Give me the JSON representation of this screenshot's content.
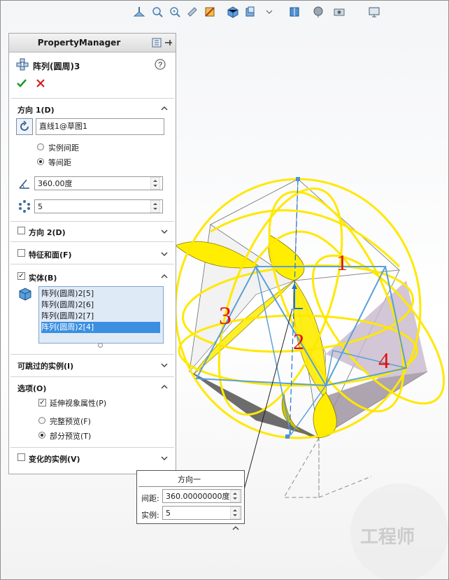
{
  "panel": {
    "title": "PropertyManager",
    "feature_name": "阵列(圆周)3",
    "ok_icon": "check-icon",
    "cancel_icon": "close-icon"
  },
  "direction1": {
    "header": "方向 1(D)",
    "axis_value": "直线1@草图1",
    "radio_instance_spacing": "实例间距",
    "radio_equal_spacing": "等间距",
    "selected_radio": "等间距",
    "angle_value": "360.00度",
    "count_value": "5"
  },
  "direction2": {
    "header": "方向 2(D)",
    "checked": false
  },
  "features_faces": {
    "header": "特征和面(F)",
    "checked": false
  },
  "bodies": {
    "header": "实体(B)",
    "checked": true,
    "items": [
      "阵列(圆周)2[5]",
      "阵列(圆周)2[6]",
      "阵列(圆周)2[7]",
      "阵列(圆周)2[4]"
    ],
    "selected_index": 3
  },
  "skip_instances": {
    "header": "可跳过的实例(I)"
  },
  "options": {
    "header": "选项(O)",
    "extend_visual": "延伸视象属性(P)",
    "extend_visual_checked": true,
    "full_preview": "完整预览(F)",
    "partial_preview": "部分预览(T)",
    "selected_preview": "部分预览(T)"
  },
  "varying_instances": {
    "header": "变化的实例(V)",
    "checked": false
  },
  "callout": {
    "title": "方向一",
    "spacing_label": "间距:",
    "spacing_value": "360.00000000度",
    "instances_label": "实例:",
    "instances_value": "5"
  },
  "annotations": [
    "1",
    "2",
    "3",
    "4"
  ],
  "watermark": "工程师",
  "colors": {
    "model_yellow": "#ffee00",
    "edge_blue": "#5aa0d8",
    "sketch_red": "#e01010",
    "selection_blue": "#3a8fe0"
  }
}
